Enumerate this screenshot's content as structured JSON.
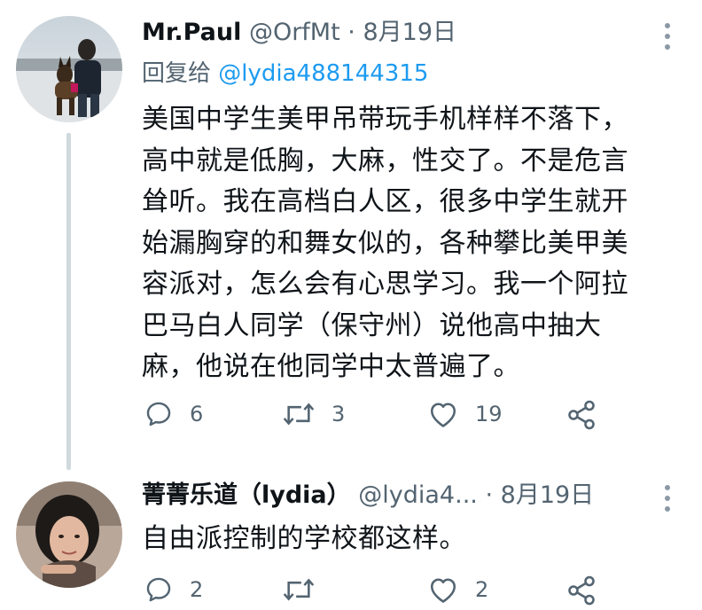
{
  "tweets": [
    {
      "name": "Mr.Paul",
      "handle": "@OrfMt",
      "separator": "·",
      "date": "8月19日",
      "replying_prefix": "回复给 ",
      "replying_to": "@lydia488144315",
      "text_lines": [
        "美国中学生美甲吊带玩手机样样不落下，",
        "高中就是低胸，大麻，性交了。不是危言",
        "耸听。我在高档白人区，很多中学生就开",
        "始漏胸穿的和舞女似的，各种攀比美甲美",
        "容派对，怎么会有心思学习。我一个阿拉",
        "巴马白人同学（保守州）说他高中抽大",
        "麻，他说在他同学中太普遍了。"
      ],
      "reply_count": "6",
      "retweet_count": "3",
      "like_count": "19"
    },
    {
      "name": "菁菁乐道（lydia）",
      "handle": "@lydia4...",
      "separator": "·",
      "date": "8月19日",
      "text_lines": [
        "自由派控制的学校都这样。"
      ],
      "reply_count": "2",
      "retweet_count": "",
      "like_count": "2"
    }
  ],
  "icons": {
    "reply": "reply-icon",
    "retweet": "retweet-icon",
    "like": "heart-icon",
    "share": "share-icon",
    "more": "more-icon"
  },
  "colors": {
    "link": "#1d9bf0",
    "secondary": "#536471",
    "thread_line": "#cfd9de"
  }
}
